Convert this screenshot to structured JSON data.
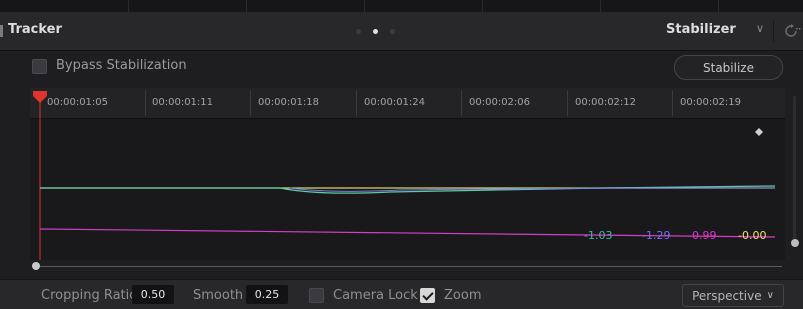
{
  "header": {
    "title": "Tracker",
    "mode": "Stabilizer",
    "mode_chevron": "∨",
    "more": "··"
  },
  "controls": {
    "bypass_label": "Bypass Stabilization",
    "bypass_checked": false,
    "stabilize_button": "Stabilize"
  },
  "timeline": {
    "timecodes": [
      "00:00:01:05",
      "00:00:01:11",
      "00:00:01:18",
      "00:00:01:24",
      "00:00:02:06",
      "00:00:02:12",
      "00:00:02:19"
    ],
    "playhead_color": "#e0342c"
  },
  "graph": {
    "curves": [
      {
        "color": "#d9d46a"
      },
      {
        "color": "#5fc9a8"
      },
      {
        "color": "#7b7be8"
      },
      {
        "color": "#d33ec6"
      }
    ],
    "values": [
      {
        "text": "-1.03",
        "color": "#3fb8a4"
      },
      {
        "text": "-1.29",
        "color": "#7a6ff0"
      },
      {
        "text": "0.99",
        "color": "#d838c8"
      },
      {
        "text": "-0.00",
        "color": "#e8e070"
      }
    ]
  },
  "footer": {
    "cropping_label": "Cropping Ratio",
    "cropping_value": "0.50",
    "smooth_label": "Smooth",
    "smooth_value": "0.25",
    "camera_lock_label": "Camera Lock",
    "camera_lock_checked": false,
    "zoom_label": "Zoom",
    "zoom_checked": true,
    "perspective_label": "Perspective",
    "perspective_chevron": "∨"
  }
}
